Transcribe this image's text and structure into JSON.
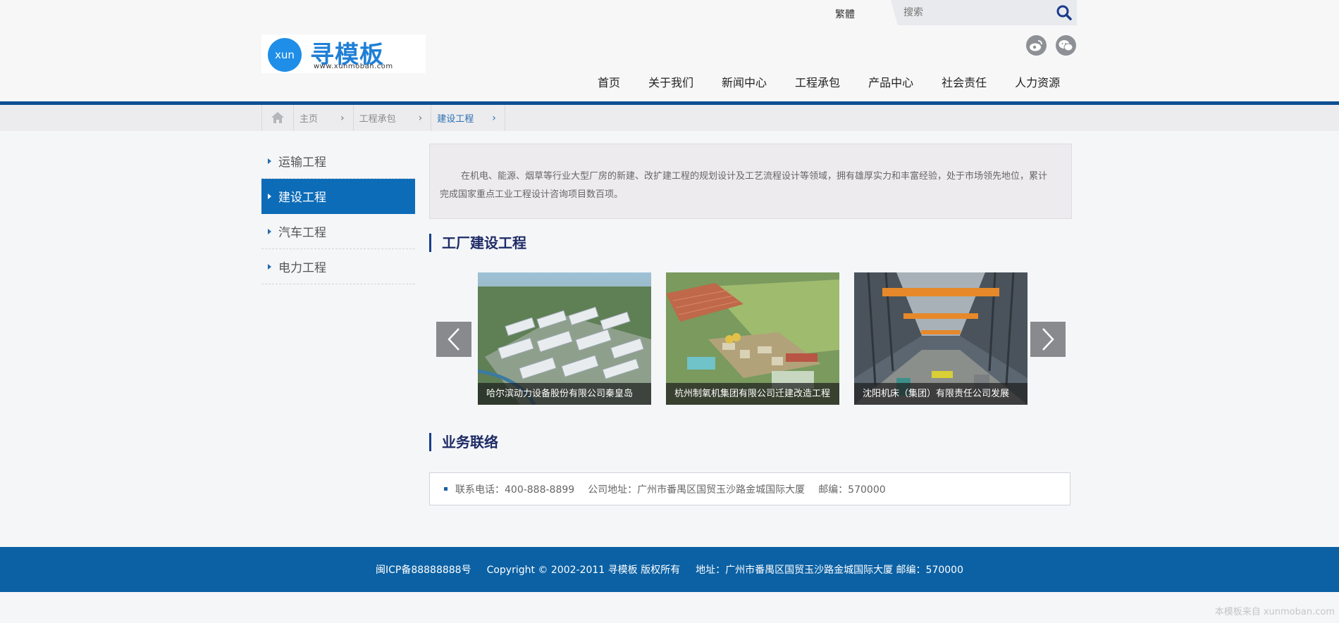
{
  "header": {
    "logo": {
      "badge_text": "xun",
      "name": "寻模板",
      "url": "www.xunmoban.com"
    },
    "lang_toggle": "繁體",
    "search": {
      "placeholder": "搜索",
      "icon": "search-icon"
    },
    "social": [
      {
        "icon": "weibo-icon"
      },
      {
        "icon": "wechat-icon"
      }
    ],
    "nav": [
      "首页",
      "关于我们",
      "新闻中心",
      "工程承包",
      "产品中心",
      "社会责任",
      "人力资源"
    ]
  },
  "breadcrumb": {
    "home_icon": "home-icon",
    "items": [
      "主页",
      "工程承包",
      "建设工程"
    ]
  },
  "sidebar": {
    "items": [
      "运输工程",
      "建设工程",
      "汽车工程",
      "电力工程"
    ],
    "active": "建设工程"
  },
  "main": {
    "intro": "在机电、能源、烟草等行业大型厂房的新建、改扩建工程的规划设计及工艺流程设计等领域，拥有雄厚实力和丰富经验，处于市场领先地位，累计完成国家重点工业工程设计咨询项目数百项。",
    "projects_title": "工厂建设工程",
    "projects": [
      {
        "caption": "哈尔滨动力设备股份有限公司秦皇岛"
      },
      {
        "caption": "杭州制氧机集团有限公司迁建改造工程"
      },
      {
        "caption": "沈阳机床（集团）有限责任公司发展"
      }
    ],
    "contact_title": "业务联络",
    "contact": {
      "phone": "联系电话：400-888-8899",
      "address": "公司地址：广州市番禺区国贸玉沙路金城国际大厦",
      "postcode": "邮编：570000"
    }
  },
  "footer": {
    "icp": "闽ICP备88888888号",
    "copyright": "Copyright © 2002-2011 寻模板 版权所有",
    "address": "地址：广州市番禺区国贸玉沙路金城国际大厦 邮编：570000"
  },
  "watermark": "本模板来自 xunmoban.com",
  "colors": {
    "brand_blue": "#0b61a4",
    "active_blue": "#0d6cb8",
    "title_navy": "#1e2b66"
  }
}
